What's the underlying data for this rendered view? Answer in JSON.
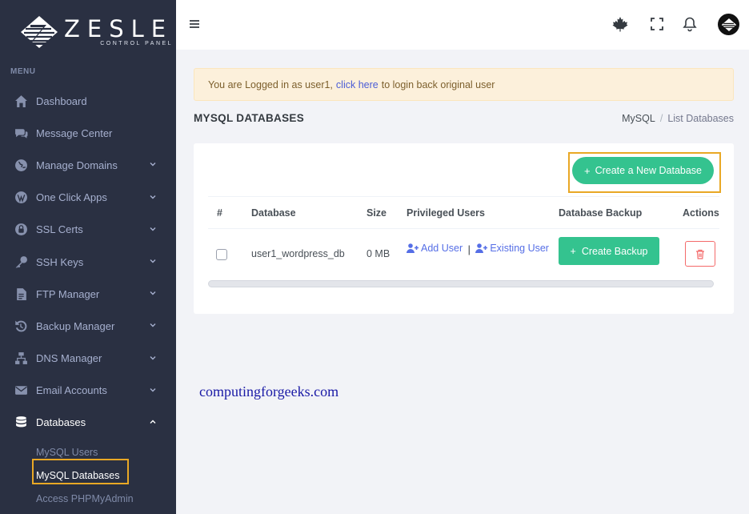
{
  "brand": {
    "name": "ZESLE",
    "tagline": "CONTROL PANEL"
  },
  "sidebar": {
    "menu_title": "MENU",
    "items": [
      {
        "label": "Dashboard",
        "icon": "home-icon",
        "has_chevron": false
      },
      {
        "label": "Message Center",
        "icon": "chat-icon",
        "has_chevron": false
      },
      {
        "label": "Manage Domains",
        "icon": "globe-icon",
        "has_chevron": true
      },
      {
        "label": "One Click Apps",
        "icon": "wordpress-icon",
        "has_chevron": true
      },
      {
        "label": "SSL Certs",
        "icon": "lock-icon",
        "has_chevron": true
      },
      {
        "label": "SSH Keys",
        "icon": "key-icon",
        "has_chevron": true
      },
      {
        "label": "FTP Manager",
        "icon": "file-icon",
        "has_chevron": true
      },
      {
        "label": "Backup Manager",
        "icon": "history-icon",
        "has_chevron": true
      },
      {
        "label": "DNS Manager",
        "icon": "network-icon",
        "has_chevron": true
      },
      {
        "label": "Email Accounts",
        "icon": "envelope-icon",
        "has_chevron": true
      },
      {
        "label": "Databases",
        "icon": "database-icon",
        "has_chevron": true,
        "expanded": true
      }
    ],
    "subitems": [
      {
        "label": "MySQL Users"
      },
      {
        "label": "MySQL Databases",
        "current": true
      },
      {
        "label": "Access PHPMyAdmin"
      }
    ]
  },
  "topbar": {
    "icons": [
      "menu-icon",
      "maple-leaf-icon",
      "fullscreen-icon",
      "bell-icon",
      "user-avatar"
    ]
  },
  "alert": {
    "prefix": "You are Logged in as user1,",
    "link": "click here",
    "suffix": "to login back original user"
  },
  "page": {
    "title": "MYSQL DATABASES"
  },
  "breadcrumb": {
    "parent": "MySQL",
    "current": "List Databases"
  },
  "card": {
    "create_button": "Create a New Database",
    "columns": [
      "#",
      "Database",
      "Size",
      "Privileged Users",
      "Database Backup",
      "Actions"
    ],
    "rows": [
      {
        "database": "user1_wordpress_db",
        "size": "0 MB",
        "add_user": "Add User",
        "separator": "|",
        "existing_user": "Existing User",
        "backup_button": "Create Backup"
      }
    ]
  },
  "watermark": "computingforgeeks.com",
  "colors": {
    "sidebar_bg": "#2a3042",
    "accent_green": "#34c38f",
    "link_blue": "#556ee6",
    "danger_red": "#f46a6a",
    "highlight_orange": "#e9a825"
  }
}
